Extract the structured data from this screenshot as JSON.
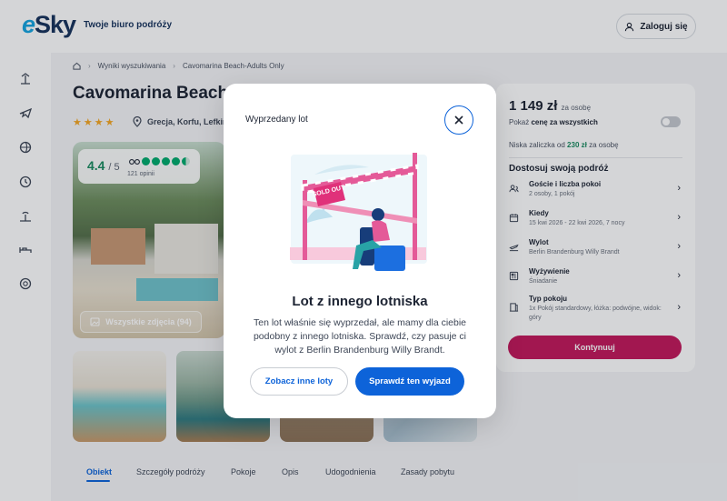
{
  "header": {
    "logo_text": "eSky",
    "logo_accent": "e",
    "logo_rest": "Sky",
    "tagline": "Twoje biuro podróży",
    "login_label": "Zaloguj się"
  },
  "rail": {
    "icons": [
      "beach-icon",
      "plane-icon",
      "globe-icon",
      "clock-icon",
      "island-icon",
      "bed-icon",
      "lifebuoy-icon"
    ]
  },
  "breadcrumb": {
    "home_icon": "home-icon",
    "items": [
      "Wyniki wyszukiwania",
      "Cavomarina Beach-Adults Only"
    ]
  },
  "hotel": {
    "title": "Cavomarina Beach",
    "stars": "★★★★",
    "location": "Grecja, Korfu, Lefkim",
    "rating_score": "4.4",
    "rating_max": "/ 5",
    "tripadvisor_rating": 4.5,
    "reviews": "121 opinii",
    "photos_label": "Wszystkie zdjęcia (94)"
  },
  "tabs": [
    "Obiekt",
    "Szczegóły podróży",
    "Pokoje",
    "Opis",
    "Udogodnienia",
    "Zasady pobytu"
  ],
  "panel": {
    "price": "1 149 zł",
    "price_unit": "za osobę",
    "all_price_prefix": "Pokaż",
    "all_price_bold": "cenę za wszystkich",
    "deposit_prefix": "Niska zaliczka od",
    "deposit_amount": "230 zł",
    "deposit_suffix": "za osobę",
    "customize_title": "Dostosuj swoją podróż",
    "options": [
      {
        "label": "Goście i liczba pokoi",
        "value": "2 osoby, 1 pokój",
        "icon": "guests-icon"
      },
      {
        "label": "Kiedy",
        "value": "15 kwi 2026 - 22 kwi 2026, 7 nocy",
        "icon": "calendar-icon"
      },
      {
        "label": "Wylot",
        "value": "Berlin Brandenburg Willy Brandt",
        "icon": "departure-icon"
      },
      {
        "label": "Wyżywienie",
        "value": "Śniadanie",
        "icon": "meal-icon"
      },
      {
        "label": "Typ pokoju",
        "value": "1x Pokój standardowy, łóżka: podwójne, widok: góry",
        "icon": "room-icon"
      }
    ],
    "continue_label": "Kontynuuj"
  },
  "modal": {
    "title": "Wyprzedany lot",
    "sold_out_badge": "SOLD OUT",
    "heading": "Lot z innego lotniska",
    "text": "Ten lot właśnie się wyprzedał, ale mamy dla ciebie podobny z innego lotniska. Sprawdź, czy pasuje ci wylot z Berlin Brandenburg Willy Brandt.",
    "btn_other": "Zobacz inne loty",
    "btn_check": "Sprawdź ten wyjazd"
  },
  "colors": {
    "primary": "#0d63d9",
    "continue": "#c2185b",
    "brand_navy": "#16325c",
    "brand_blue": "#14a4e0",
    "rating_green": "#198a5f"
  }
}
